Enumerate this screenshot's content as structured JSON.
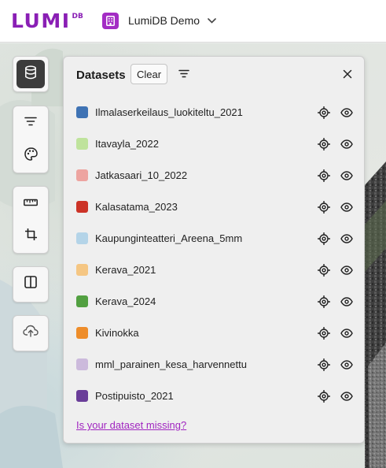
{
  "app": {
    "logo_text": "LUMI",
    "logo_superscript": "DB",
    "project_name": "LumiDB Demo"
  },
  "panel": {
    "title": "Datasets",
    "clear_label": "Clear",
    "missing_link": "Is your dataset missing?"
  },
  "datasets": [
    {
      "name": "Ilmalaserkeilaus_luokiteltu_2021",
      "color": "#3f73b4"
    },
    {
      "name": "Itavayla_2022",
      "color": "#bfe39c"
    },
    {
      "name": "Jatkasaari_10_2022",
      "color": "#eda4a0"
    },
    {
      "name": "Kalasatama_2023",
      "color": "#cc3327"
    },
    {
      "name": "Kaupunginteatteri_Areena_5mm",
      "color": "#b4d4e8"
    },
    {
      "name": "Kerava_2021",
      "color": "#f5c683"
    },
    {
      "name": "Kerava_2024",
      "color": "#52a041"
    },
    {
      "name": "Kivinokka",
      "color": "#ee8d2a"
    },
    {
      "name": "mml_parainen_kesa_harvennettu",
      "color": "#ccbadc"
    },
    {
      "name": "Postipuisto_2021",
      "color": "#6a3d99"
    }
  ],
  "icons": {
    "project": "building-icon",
    "project_menu": "chevron-down-icon",
    "toolbar": [
      "database-icon",
      "filter-icon",
      "palette-icon",
      "ruler-icon",
      "crop-icon",
      "split-view-icon",
      "cloud-upload-icon"
    ],
    "row_actions": [
      "locate-icon",
      "eye-icon"
    ],
    "panel_close": "close-icon"
  },
  "colors": {
    "brand": "#8a1fb5",
    "link": "#a024c0",
    "active_tool": "#3c3c3c"
  }
}
